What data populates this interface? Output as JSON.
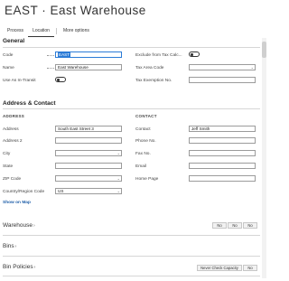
{
  "page": {
    "title": "EAST · East Warehouse"
  },
  "actions": [
    {
      "label": "Process"
    },
    {
      "label": "Location"
    },
    {
      "label": "More options"
    }
  ],
  "general": {
    "title": "General",
    "code_label": "Code",
    "code_value": "EAST",
    "name_label": "Name",
    "name_value": "East Warehouse",
    "use_as_in_transit_label": "Use As In-Transit",
    "exclude_label": "Exclude from Tax Calc...",
    "tax_area_label": "Tax Area Code",
    "tax_exemption_label": "Tax Exemption No."
  },
  "address_contact": {
    "title": "Address & Contact",
    "address_group": "ADDRESS",
    "contact_group": "CONTACT",
    "address_label": "Address",
    "address_value": "South East Street 3",
    "address2_label": "Address 2",
    "city_label": "City",
    "state_label": "State",
    "zip_label": "ZIP Code",
    "country_label": "Country/Region Code",
    "country_value": "US",
    "show_on_map": "Show on Map",
    "contact_label": "Contact",
    "contact_value": "Jeff Smith",
    "phone_label": "Phone No.",
    "fax_label": "Fax No.",
    "email_label": "Email",
    "homepage_label": "Home Page"
  },
  "warehouse": {
    "title": "Warehouse",
    "pills": [
      "No",
      "No",
      "No"
    ]
  },
  "bins": {
    "title": "Bins"
  },
  "bin_policies": {
    "title": "Bin Policies",
    "pills": [
      "Never Check Capacity",
      "No"
    ]
  }
}
